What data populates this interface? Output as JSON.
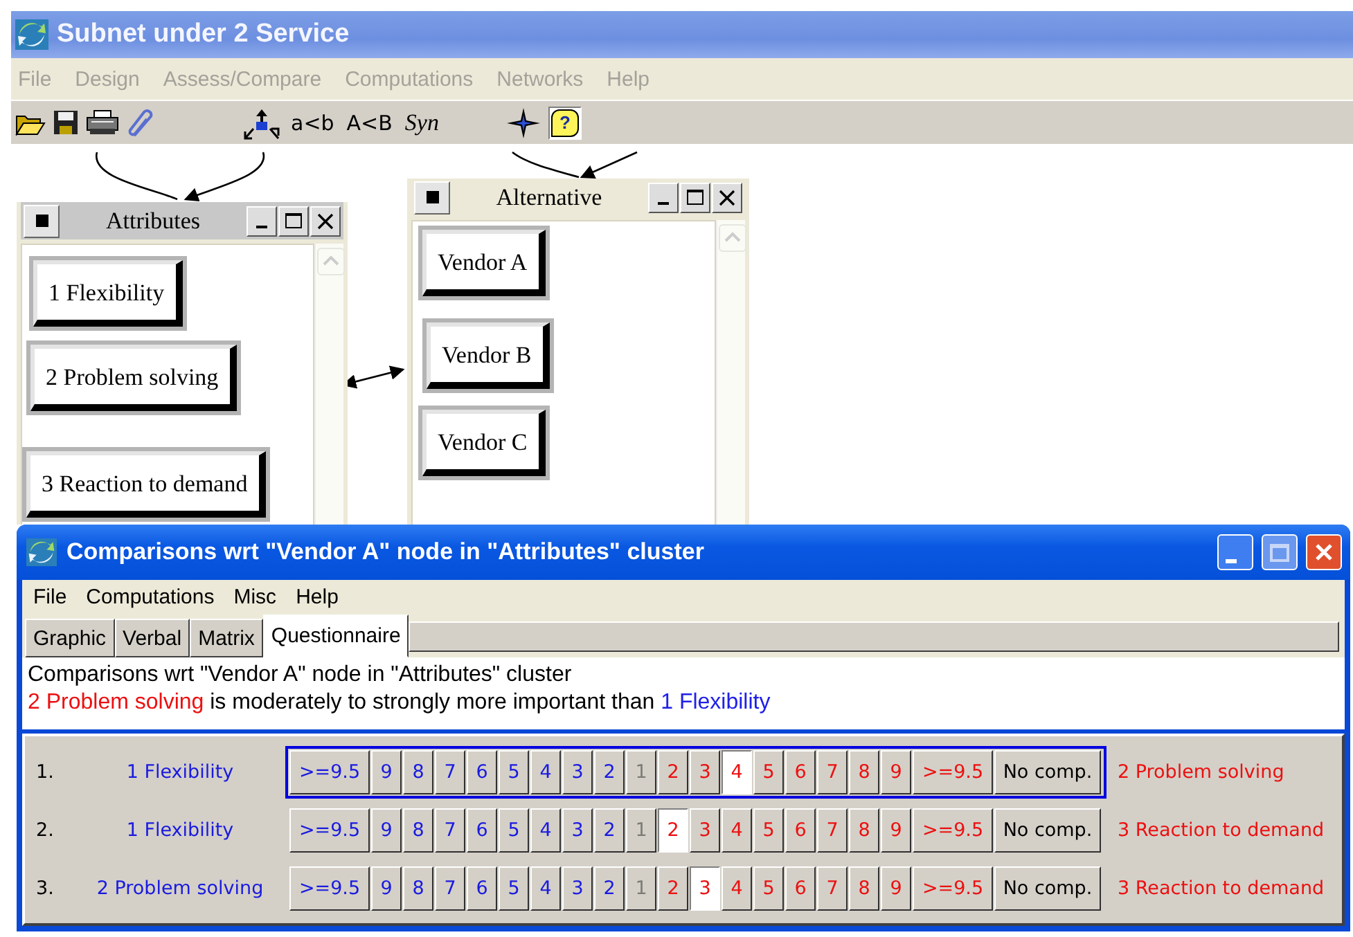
{
  "window": {
    "title": "Subnet under 2 Service"
  },
  "menu": [
    {
      "label": "File",
      "disabled": true
    },
    {
      "label": "Design",
      "disabled": true
    },
    {
      "label": "Assess/Compare",
      "disabled": true
    },
    {
      "label": "Computations",
      "disabled": true
    },
    {
      "label": "Networks",
      "disabled": true
    },
    {
      "label": "Help",
      "disabled": true
    }
  ],
  "toolbar": {
    "text_buttons": [
      {
        "label": "a<b",
        "kind": "plain"
      },
      {
        "label": "A<B",
        "kind": "plain"
      },
      {
        "label": "Syn",
        "kind": "script"
      }
    ],
    "help_button": {
      "label": "?",
      "selected": true
    }
  },
  "clusters": [
    {
      "title": "Attributes",
      "nodes": [
        "1 Flexibility",
        "2 Problem solving",
        "3 Reaction to demand"
      ]
    },
    {
      "title": "Alternative",
      "nodes": [
        "Vendor A",
        "Vendor B",
        "Vendor C"
      ]
    }
  ],
  "comparison_window": {
    "title": "Comparisons wrt \"Vendor A\" node in \"Attributes\" cluster",
    "menu": [
      "File",
      "Computations",
      "Misc",
      "Help"
    ],
    "tabs": [
      {
        "label": "Graphic",
        "selected": false
      },
      {
        "label": "Verbal",
        "selected": false
      },
      {
        "label": "Matrix",
        "selected": false
      },
      {
        "label": "Questionnaire",
        "selected": true
      }
    ],
    "heading": "Comparisons wrt \"Vendor A\" node in \"Attributes\" cluster",
    "verdict": [
      {
        "text": "2 Problem solving",
        "kind": "right"
      },
      {
        "text": " is moderately to strongly more important than ",
        "kind": "plain"
      },
      {
        "text": "1 Flexibility",
        "kind": "left"
      }
    ],
    "rows": [
      {
        "number": "1.",
        "left": "1 Flexibility",
        "right": "2 Problem solving",
        "focused": true,
        "cells": [
          {
            "label": ">=9.5",
            "kind": "left",
            "selected": false
          },
          {
            "label": "9",
            "kind": "left",
            "selected": false
          },
          {
            "label": "8",
            "kind": "left",
            "selected": false
          },
          {
            "label": "7",
            "kind": "left",
            "selected": false
          },
          {
            "label": "6",
            "kind": "left",
            "selected": false
          },
          {
            "label": "5",
            "kind": "left",
            "selected": false
          },
          {
            "label": "4",
            "kind": "left",
            "selected": false
          },
          {
            "label": "3",
            "kind": "left",
            "selected": false
          },
          {
            "label": "2",
            "kind": "left",
            "selected": false
          },
          {
            "label": "1",
            "kind": "middle",
            "selected": false
          },
          {
            "label": "2",
            "kind": "right",
            "selected": false
          },
          {
            "label": "3",
            "kind": "right",
            "selected": false
          },
          {
            "label": "4",
            "kind": "right",
            "selected": true
          },
          {
            "label": "5",
            "kind": "right",
            "selected": false
          },
          {
            "label": "6",
            "kind": "right",
            "selected": false
          },
          {
            "label": "7",
            "kind": "right",
            "selected": false
          },
          {
            "label": "8",
            "kind": "right",
            "selected": false
          },
          {
            "label": "9",
            "kind": "right",
            "selected": false
          },
          {
            "label": ">=9.5",
            "kind": "right",
            "selected": false
          },
          {
            "label": "No comp.",
            "kind": "none",
            "selected": false
          }
        ]
      },
      {
        "number": "2.",
        "left": "1 Flexibility",
        "right": "3 Reaction to demand",
        "focused": false,
        "cells": [
          {
            "label": ">=9.5",
            "kind": "left",
            "selected": false
          },
          {
            "label": "9",
            "kind": "left",
            "selected": false
          },
          {
            "label": "8",
            "kind": "left",
            "selected": false
          },
          {
            "label": "7",
            "kind": "left",
            "selected": false
          },
          {
            "label": "6",
            "kind": "left",
            "selected": false
          },
          {
            "label": "5",
            "kind": "left",
            "selected": false
          },
          {
            "label": "4",
            "kind": "left",
            "selected": false
          },
          {
            "label": "3",
            "kind": "left",
            "selected": false
          },
          {
            "label": "2",
            "kind": "left",
            "selected": false
          },
          {
            "label": "1",
            "kind": "middle",
            "selected": false
          },
          {
            "label": "2",
            "kind": "right",
            "selected": true
          },
          {
            "label": "3",
            "kind": "right",
            "selected": false
          },
          {
            "label": "4",
            "kind": "right",
            "selected": false
          },
          {
            "label": "5",
            "kind": "right",
            "selected": false
          },
          {
            "label": "6",
            "kind": "right",
            "selected": false
          },
          {
            "label": "7",
            "kind": "right",
            "selected": false
          },
          {
            "label": "8",
            "kind": "right",
            "selected": false
          },
          {
            "label": "9",
            "kind": "right",
            "selected": false
          },
          {
            "label": ">=9.5",
            "kind": "right",
            "selected": false
          },
          {
            "label": "No comp.",
            "kind": "none",
            "selected": false
          }
        ]
      },
      {
        "number": "3.",
        "left": "2 Problem solving",
        "right": "3 Reaction to demand",
        "focused": false,
        "cells": [
          {
            "label": ">=9.5",
            "kind": "left",
            "selected": false
          },
          {
            "label": "9",
            "kind": "left",
            "selected": false
          },
          {
            "label": "8",
            "kind": "left",
            "selected": false
          },
          {
            "label": "7",
            "kind": "left",
            "selected": false
          },
          {
            "label": "6",
            "kind": "left",
            "selected": false
          },
          {
            "label": "5",
            "kind": "left",
            "selected": false
          },
          {
            "label": "4",
            "kind": "left",
            "selected": false
          },
          {
            "label": "3",
            "kind": "left",
            "selected": false
          },
          {
            "label": "2",
            "kind": "left",
            "selected": false
          },
          {
            "label": "1",
            "kind": "middle",
            "selected": false
          },
          {
            "label": "2",
            "kind": "right",
            "selected": false
          },
          {
            "label": "3",
            "kind": "right",
            "selected": true
          },
          {
            "label": "4",
            "kind": "right",
            "selected": false
          },
          {
            "label": "5",
            "kind": "right",
            "selected": false
          },
          {
            "label": "6",
            "kind": "right",
            "selected": false
          },
          {
            "label": "7",
            "kind": "right",
            "selected": false
          },
          {
            "label": "8",
            "kind": "right",
            "selected": false
          },
          {
            "label": "9",
            "kind": "right",
            "selected": false
          },
          {
            "label": ">=9.5",
            "kind": "right",
            "selected": false
          },
          {
            "label": "No comp.",
            "kind": "none",
            "selected": false
          }
        ]
      }
    ]
  }
}
